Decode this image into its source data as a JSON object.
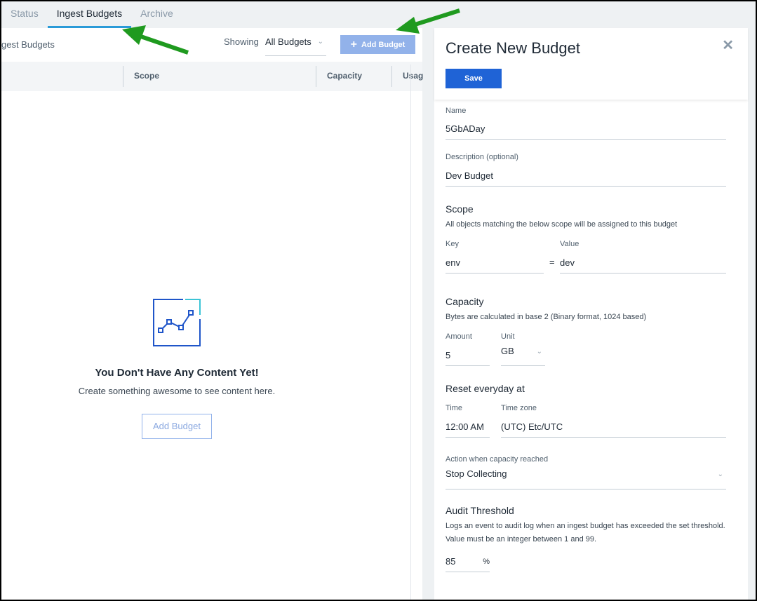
{
  "tabs": [
    "Status",
    "Ingest Budgets",
    "Archive"
  ],
  "left": {
    "title": "gest Budgets",
    "showing_label": "Showing",
    "filter_value": "All Budgets",
    "add_button": "Add Budget",
    "columns": [
      "Scope",
      "Capacity",
      "Usag"
    ],
    "empty": {
      "title": "You Don't Have Any Content Yet!",
      "subtitle": "Create something awesome to see content here.",
      "button": "Add Budget"
    }
  },
  "panel": {
    "title": "Create New Budget",
    "save": "Save",
    "name_label": "Name",
    "name_value": "5GbADay",
    "desc_label": "Description (optional)",
    "desc_value": "Dev Budget",
    "scope_title": "Scope",
    "scope_note": "All objects matching the below scope will be assigned to this budget",
    "key_label": "Key",
    "key_value": "env",
    "equals": "=",
    "value_label": "Value",
    "value_value": "dev",
    "capacity_title": "Capacity",
    "capacity_note": "Bytes are calculated in base 2 (Binary format, 1024 based)",
    "amount_label": "Amount",
    "amount_value": "5",
    "unit_label": "Unit",
    "unit_value": "GB",
    "reset_title": "Reset everyday at",
    "time_label": "Time",
    "time_value": "12:00 AM",
    "tz_label": "Time zone",
    "tz_value": "(UTC) Etc/UTC",
    "action_label": "Action when capacity reached",
    "action_value": "Stop Collecting",
    "audit_title": "Audit Threshold",
    "audit_note": "Logs an event to audit log when an ingest budget has exceeded the set threshold. Value must be an integer between 1 and 99.",
    "audit_value": "85",
    "audit_unit": "%"
  },
  "colors": {
    "accent": "#1f63d6",
    "tab_underline": "#2a9bd8",
    "annotation_arrow": "#1f9a1f"
  }
}
